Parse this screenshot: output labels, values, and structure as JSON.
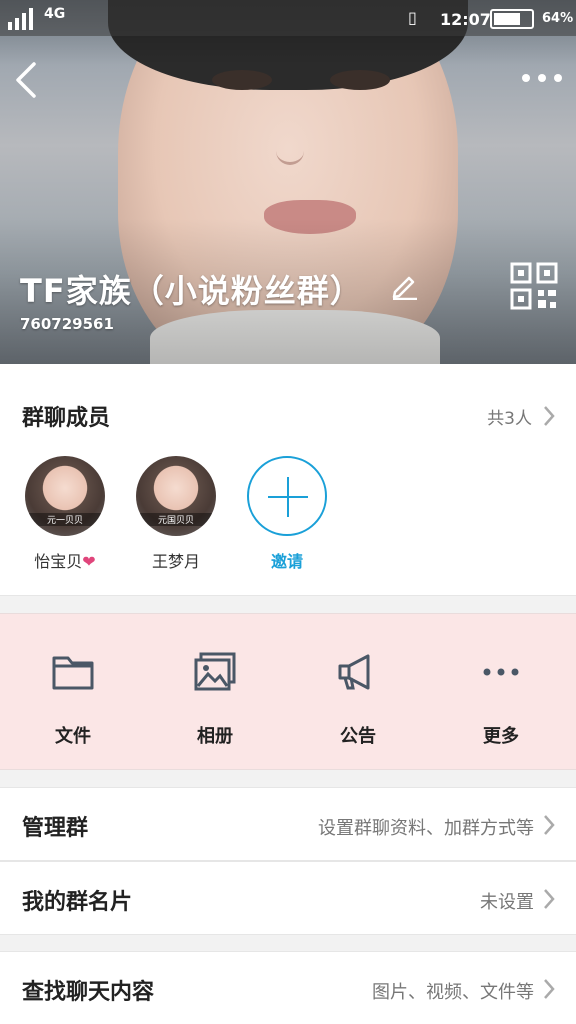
{
  "status_bar": {
    "network": "4G",
    "time": "12:07",
    "battery": "64%",
    "battery_level": 0.64,
    "icons": [
      "signal-icon",
      "vibrate-icon",
      "battery-icon"
    ]
  },
  "header": {
    "group_name": "TF家族（小说粉丝群）",
    "group_id": "760729561",
    "icons": [
      "back-icon",
      "more-icon",
      "edit-icon",
      "qr-code-icon"
    ]
  },
  "members": {
    "title": "群聊成员",
    "count": "共3人",
    "list": [
      {
        "name": "怡宝贝",
        "caption": "元一贝贝"
      },
      {
        "name": "王梦月",
        "caption": "元国贝贝"
      }
    ],
    "invite_label": "邀请"
  },
  "actions": [
    {
      "label": "文件",
      "icon": "folder-icon"
    },
    {
      "label": "相册",
      "icon": "album-icon"
    },
    {
      "label": "公告",
      "icon": "announcement-icon"
    },
    {
      "label": "更多",
      "icon": "more-dots-icon"
    }
  ],
  "settings": [
    {
      "title": "管理群",
      "value": "设置群聊资料、加群方式等"
    },
    {
      "title": "我的群名片",
      "value": "未设置"
    },
    {
      "title": "查找聊天内容",
      "value": "图片、视频、文件等"
    }
  ],
  "colors": {
    "accent": "#1aa0d8",
    "actions_bg": "#fbe6e6",
    "heart": "#e0457b"
  }
}
